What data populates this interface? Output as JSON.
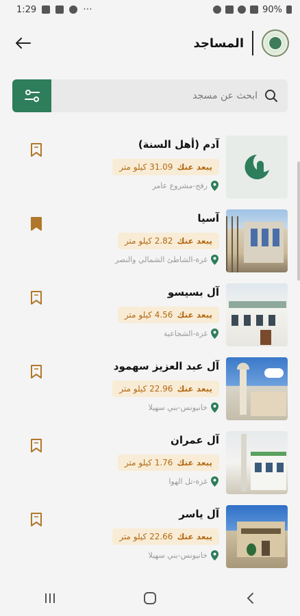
{
  "status": {
    "time": "1:29",
    "battery": "90%"
  },
  "header": {
    "title": "المساجد"
  },
  "search": {
    "placeholder": "ابحث عن مسجد"
  },
  "colors": {
    "accent": "#2e7d5b",
    "distance_bg": "#f8ecd6",
    "distance_text": "#b36a14",
    "bookmark": "#b0772a"
  },
  "mosques": [
    {
      "name": "آدم (أهل السنة)",
      "distance_label": "يبعد عنك",
      "distance_value": "31.09 كيلو متر",
      "location": "رفح-مشروع عامر",
      "bookmarked": false,
      "thumb": "mosque-placeholder"
    },
    {
      "name": "آسيا",
      "distance_label": "يبعد عنك",
      "distance_value": "2.82 كيلو متر",
      "location": "غزة-الشاطئ الشمالي والنصر",
      "bookmarked": true,
      "thumb": "photo"
    },
    {
      "name": "آل بسيسو",
      "distance_label": "يبعد عنك",
      "distance_value": "4.56 كيلو متر",
      "location": "غزة-الشجاعية",
      "bookmarked": false,
      "thumb": "photo"
    },
    {
      "name": "آل عبد العزيز سهمود",
      "distance_label": "يبعد عنك",
      "distance_value": "22.96 كيلو متر",
      "location": "خانيونس-بني سهيلا",
      "bookmarked": false,
      "thumb": "photo"
    },
    {
      "name": "آل عمران",
      "distance_label": "يبعد عنك",
      "distance_value": "1.76 كيلو متر",
      "location": "غزة-تل الهوا",
      "bookmarked": false,
      "thumb": "photo"
    },
    {
      "name": "آل ياسر",
      "distance_label": "يبعد عنك",
      "distance_value": "22.66 كيلو متر",
      "location": "خانيونس-بني سهيلا",
      "bookmarked": false,
      "thumb": "photo"
    }
  ]
}
